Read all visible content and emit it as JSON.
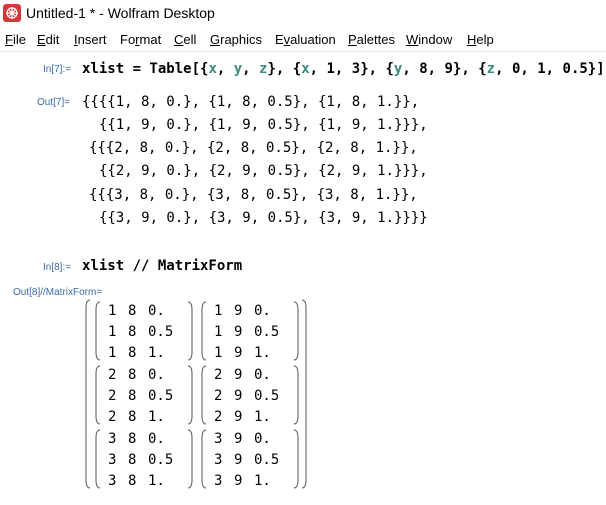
{
  "window": {
    "title": "Untitled-1 * - Wolfram Desktop"
  },
  "menu": [
    {
      "mn": "F",
      "rest": "ile"
    },
    {
      "mn": "E",
      "rest": "dit"
    },
    {
      "mn": "I",
      "rest": "nsert"
    },
    {
      "pre": "Fo",
      "mn": "r",
      "rest": "mat"
    },
    {
      "mn": "C",
      "rest": "ell"
    },
    {
      "mn": "G",
      "rest": "raphics"
    },
    {
      "pre": "E",
      "mn": "v",
      "rest": "aluation"
    },
    {
      "mn": "P",
      "rest": "alettes"
    },
    {
      "mn": "W",
      "rest": "indow"
    },
    {
      "mn": "H",
      "rest": "elp"
    }
  ],
  "cells": {
    "in7": {
      "label": "In[7]:=",
      "tokens": [
        "xlist = Table[{",
        "x",
        ", ",
        "y",
        ", ",
        "z",
        "}, {",
        "x",
        ", 1, 3}, {",
        "y",
        ", 8, 9}, {",
        "z",
        ", 0, 1, 0.5}]"
      ]
    },
    "out7": {
      "label": "Out[7]=",
      "lines": [
        "{{{{1, 8, 0.}, {1, 8, 0.5}, {1, 8, 1.}},",
        "{{1, 9, 0.}, {1, 9, 0.5}, {1, 9, 1.}}},",
        "{{{2, 8, 0.}, {2, 8, 0.5}, {2, 8, 1.}},",
        "{{2, 9, 0.}, {2, 9, 0.5}, {2, 9, 1.}}},",
        "{{{3, 8, 0.}, {3, 8, 0.5}, {3, 8, 1.}},",
        "{{3, 9, 0.}, {3, 9, 0.5}, {3, 9, 1.}}}}"
      ]
    },
    "in8": {
      "label": "In[8]:=",
      "text": "xlist // MatrixForm"
    },
    "out8": {
      "label": "Out[8]//MatrixForm=",
      "blocks": [
        [
          [
            [
              "1",
              "8",
              "0."
            ],
            [
              "1",
              "8",
              "0.5"
            ],
            [
              "1",
              "8",
              "1."
            ]
          ],
          [
            [
              "1",
              "9",
              "0."
            ],
            [
              "1",
              "9",
              "0.5"
            ],
            [
              "1",
              "9",
              "1."
            ]
          ]
        ],
        [
          [
            [
              "2",
              "8",
              "0."
            ],
            [
              "2",
              "8",
              "0.5"
            ],
            [
              "2",
              "8",
              "1."
            ]
          ],
          [
            [
              "2",
              "9",
              "0."
            ],
            [
              "2",
              "9",
              "0.5"
            ],
            [
              "2",
              "9",
              "1."
            ]
          ]
        ],
        [
          [
            [
              "3",
              "8",
              "0."
            ],
            [
              "3",
              "8",
              "0.5"
            ],
            [
              "3",
              "8",
              "1."
            ]
          ],
          [
            [
              "3",
              "9",
              "0."
            ],
            [
              "3",
              "9",
              "0.5"
            ],
            [
              "3",
              "9",
              "1."
            ]
          ]
        ]
      ]
    }
  },
  "colors": {
    "label": "#3a6aa8",
    "variable": "#3a8a80",
    "icon": "#d23a3a"
  },
  "icons": {
    "app": "wolfram-icon"
  }
}
